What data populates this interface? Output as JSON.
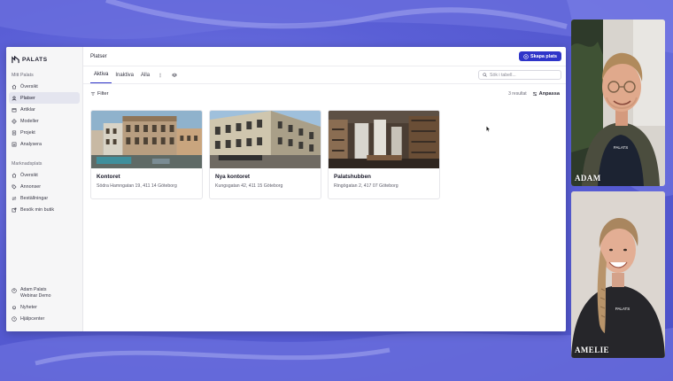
{
  "brand": {
    "name": "PALATS",
    "accent": "#2f35c9"
  },
  "sidebar": {
    "section1": "Mitt Palats",
    "items1": [
      {
        "label": "Översikt",
        "icon": "home-icon",
        "active": false
      },
      {
        "label": "Platser",
        "icon": "user-pin-icon",
        "active": true
      },
      {
        "label": "Artiklar",
        "icon": "box-icon",
        "active": false
      },
      {
        "label": "Modeller",
        "icon": "diamond-icon",
        "active": false
      },
      {
        "label": "Projekt",
        "icon": "file-icon",
        "active": false
      },
      {
        "label": "Analysera",
        "icon": "chart-icon",
        "active": false
      }
    ],
    "section2": "Marknadsplats",
    "items2": [
      {
        "label": "Översikt",
        "icon": "home-icon"
      },
      {
        "label": "Annonser",
        "icon": "tag-icon"
      },
      {
        "label": "Beställningar",
        "icon": "swap-icon"
      },
      {
        "label": "Besök min butik",
        "icon": "external-link-icon"
      }
    ],
    "account": {
      "name": "Adam Palats",
      "org": "Webinar Demo"
    },
    "footer_items": [
      {
        "label": "Nyheter",
        "icon": "bell-icon"
      },
      {
        "label": "Hjälpcenter",
        "icon": "help-icon"
      }
    ]
  },
  "header": {
    "title": "Platser",
    "create_label": "Skapa plats"
  },
  "tabs": [
    {
      "label": "Aktiva",
      "active": true
    },
    {
      "label": "Inaktiva",
      "active": false
    },
    {
      "label": "Alla",
      "active": false
    }
  ],
  "search": {
    "placeholder": "Sök i tabell..."
  },
  "toolbar": {
    "filter_label": "Filter",
    "result_count": "3 resultat",
    "customize_label": "Anpassa"
  },
  "places": [
    {
      "name": "Kontoret",
      "address": "Södra Hamngatan 19, 411 14 Göteborg"
    },
    {
      "name": "Nya kontoret",
      "address": "Kungsgatan 42, 411 15 Göteborg"
    },
    {
      "name": "Palatshubben",
      "address": "Ringögatan 2, 417 07 Göteborg"
    }
  ],
  "participants": [
    {
      "name": "ADAM"
    },
    {
      "name": "AMELIE"
    }
  ]
}
